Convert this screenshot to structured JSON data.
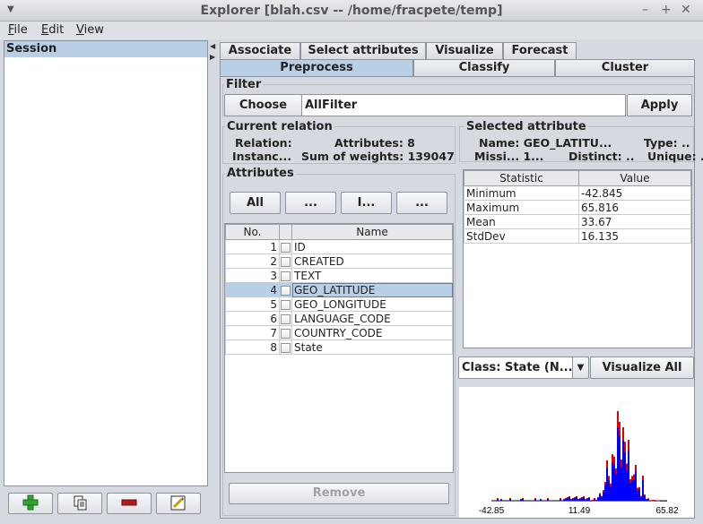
{
  "window": {
    "title": "Explorer [blah.csv -- /home/fracpete/temp]"
  },
  "menu": [
    "File",
    "Edit",
    "View"
  ],
  "session": {
    "label": "Session"
  },
  "tabs_top": [
    "Associate",
    "Select attributes",
    "Visualize",
    "Forecast"
  ],
  "tabs_bottom": [
    "Preprocess",
    "Classify",
    "Cluster"
  ],
  "filter": {
    "title": "Filter",
    "choose": "Choose",
    "value": "AllFilter",
    "apply": "Apply"
  },
  "relation": {
    "title": "Current relation",
    "relation_label": "Relation:",
    "attributes_text": "Attributes: 8",
    "instances_label": "Instanc...",
    "weights_text": "Sum of weights: 139047"
  },
  "attributes": {
    "title": "Attributes",
    "buttons": [
      "All",
      "...",
      "I...",
      "..."
    ],
    "col_no": "No.",
    "col_name": "Name",
    "rows": [
      {
        "no": "1",
        "name": "ID"
      },
      {
        "no": "2",
        "name": "CREATED"
      },
      {
        "no": "3",
        "name": "TEXT"
      },
      {
        "no": "4",
        "name": "GEO_LATITUDE"
      },
      {
        "no": "5",
        "name": "GEO_LONGITUDE"
      },
      {
        "no": "6",
        "name": "LANGUAGE_CODE"
      },
      {
        "no": "7",
        "name": "COUNTRY_CODE"
      },
      {
        "no": "8",
        "name": "State"
      }
    ],
    "remove": "Remove"
  },
  "selected": {
    "title": "Selected attribute",
    "name_text": "Name: GEO_LATITU...",
    "type_text": "Type: ..",
    "missing_text": "Missi... 1...",
    "distinct_text": "Distinct: ..",
    "unique_text": "Unique: ..",
    "col_stat": "Statistic",
    "col_value": "Value",
    "stats": [
      {
        "stat": "Minimum",
        "value": "-42.845"
      },
      {
        "stat": "Maximum",
        "value": "65.816"
      },
      {
        "stat": "Mean",
        "value": "33.67"
      },
      {
        "stat": "StdDev",
        "value": "16.135"
      }
    ]
  },
  "class_select": {
    "value": "Class: State (N...",
    "visualize_all": "Visualize All"
  },
  "histogram": {
    "axis_labels": [
      "-42.85",
      "11.49",
      "65.82"
    ],
    "colors": {
      "primary": "#0000ff",
      "secondary": "#e00000"
    }
  },
  "bottom_buttons": [
    "add-icon",
    "copy-icon",
    "remove-icon",
    "edit-icon"
  ]
}
